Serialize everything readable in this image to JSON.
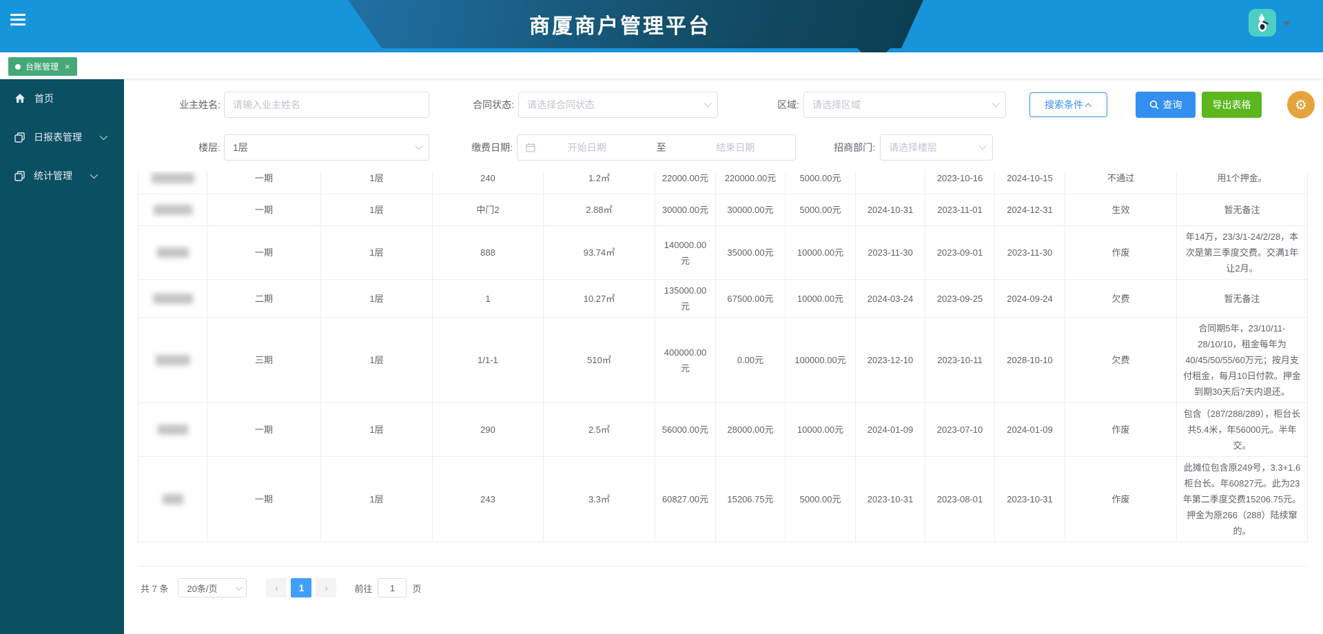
{
  "header": {
    "title": "商厦商户管理平台"
  },
  "tab": {
    "label": "台账管理",
    "close": "×"
  },
  "sidebar": {
    "items": [
      {
        "label": "首页",
        "icon": "home-icon",
        "expandable": false
      },
      {
        "label": "日报表管理",
        "icon": "copy-icon",
        "expandable": true
      },
      {
        "label": "统计管理",
        "icon": "copy-icon",
        "expandable": true
      }
    ]
  },
  "filters": {
    "owner": {
      "label": "业主姓名:",
      "placeholder": "请输入业主姓名"
    },
    "contract_status": {
      "label": "合同状态:",
      "placeholder": "请选择合同状态"
    },
    "region": {
      "label": "区域:",
      "placeholder": "请选择区域"
    },
    "floor": {
      "label": "楼层:",
      "value": "1层"
    },
    "pay_date": {
      "label": "缴费日期:",
      "start_placeholder": "开始日期",
      "separator": "至",
      "end_placeholder": "结束日期"
    },
    "dept": {
      "label": "招商部门:",
      "placeholder": "请选择楼层"
    },
    "search_toggle_label": "搜索条件",
    "query_label": "查询",
    "export_label": "导出表格",
    "gear_icon": "⚙"
  },
  "table": {
    "columns": [
      "period",
      "floor",
      "booth",
      "area",
      "amount1",
      "amount2",
      "deposit",
      "date1",
      "date2",
      "date3",
      "status",
      "remark"
    ],
    "rows": [
      {
        "blur_w": 62,
        "period": "一期",
        "floor": "1层",
        "booth": "240",
        "area": "1.2㎡",
        "amount1": "22000.00元",
        "amount2": "220000.00元",
        "deposit": "5000.00元",
        "date1": "",
        "date2": "2023-10-16",
        "date3": "2024-10-15",
        "status": "不通过",
        "remark": "用1个押金。"
      },
      {
        "blur_w": 56,
        "period": "一期",
        "floor": "1层",
        "booth": "中门2",
        "area": "2.88㎡",
        "amount1": "30000.00元",
        "amount2": "30000.00元",
        "deposit": "5000.00元",
        "date1": "2024-10-31",
        "date2": "2023-11-01",
        "date3": "2024-12-31",
        "status": "生效",
        "remark": "暂无备注"
      },
      {
        "blur_w": 46,
        "period": "一期",
        "floor": "1层",
        "booth": "888",
        "area": "93.74㎡",
        "amount1": "140000.00元",
        "amount2": "35000.00元",
        "deposit": "10000.00元",
        "date1": "2023-11-30",
        "date2": "2023-09-01",
        "date3": "2023-11-30",
        "status": "作废",
        "remark": "年14万，23/3/1-24/2/28，本次是第三季度交费。交满1年让2月。"
      },
      {
        "blur_w": 58,
        "period": "二期",
        "floor": "1层",
        "booth": "1",
        "area": "10.27㎡",
        "amount1": "135000.00元",
        "amount2": "67500.00元",
        "deposit": "10000.00元",
        "date1": "2024-03-24",
        "date2": "2023-09-25",
        "date3": "2024-09-24",
        "status": "欠费",
        "remark": "暂无备注"
      },
      {
        "blur_w": 50,
        "period": "三期",
        "floor": "1层",
        "booth": "1/1-1",
        "area": "510㎡",
        "amount1": "400000.00元",
        "amount2": "0.00元",
        "deposit": "100000.00元",
        "date1": "2023-12-10",
        "date2": "2023-10-11",
        "date3": "2028-10-10",
        "status": "欠费",
        "remark": "合同期5年，23/10/11-28/10/10，租金每年为40/45/50/55/60万元；按月支付租金，每月10日付款。押金到期30天后7天内退还。"
      },
      {
        "blur_w": 44,
        "period": "一期",
        "floor": "1层",
        "booth": "290",
        "area": "2.5㎡",
        "amount1": "56000.00元",
        "amount2": "28000.00元",
        "deposit": "10000.00元",
        "date1": "2024-01-09",
        "date2": "2023-07-10",
        "date3": "2024-01-09",
        "status": "作废",
        "remark": "包含（287/288/289），柜台长共5.4米，年56000元。半年交。"
      },
      {
        "blur_w": 30,
        "period": "一期",
        "floor": "1层",
        "booth": "243",
        "area": "3.3㎡",
        "amount1": "60827.00元",
        "amount2": "15206.75元",
        "deposit": "5000.00元",
        "date1": "2023-10-31",
        "date2": "2023-08-01",
        "date3": "2023-10-31",
        "status": "作废",
        "remark": "此摊位包含原249号，3.3+1.6柜台长。年60827元。此为23年第二季度交费15206.75元。押金为原266（288）陆续窜的。"
      }
    ]
  },
  "pagination": {
    "total": "共 7 条",
    "page_size": "20条/页",
    "prev": "‹",
    "current": "1",
    "next": "›",
    "goto_label": "前往",
    "goto_value": "1",
    "page_label": "页"
  },
  "colors": {
    "header_blue": "#1795da",
    "banner_dark": "#0b3d50",
    "sidebar_teal": "#0b4f63",
    "tab_green": "#45a878",
    "primary_blue": "#348ff0",
    "export_green": "#5cb71f",
    "gear_orange": "#e6a23c",
    "avatar_teal": "#4ecfc4"
  }
}
